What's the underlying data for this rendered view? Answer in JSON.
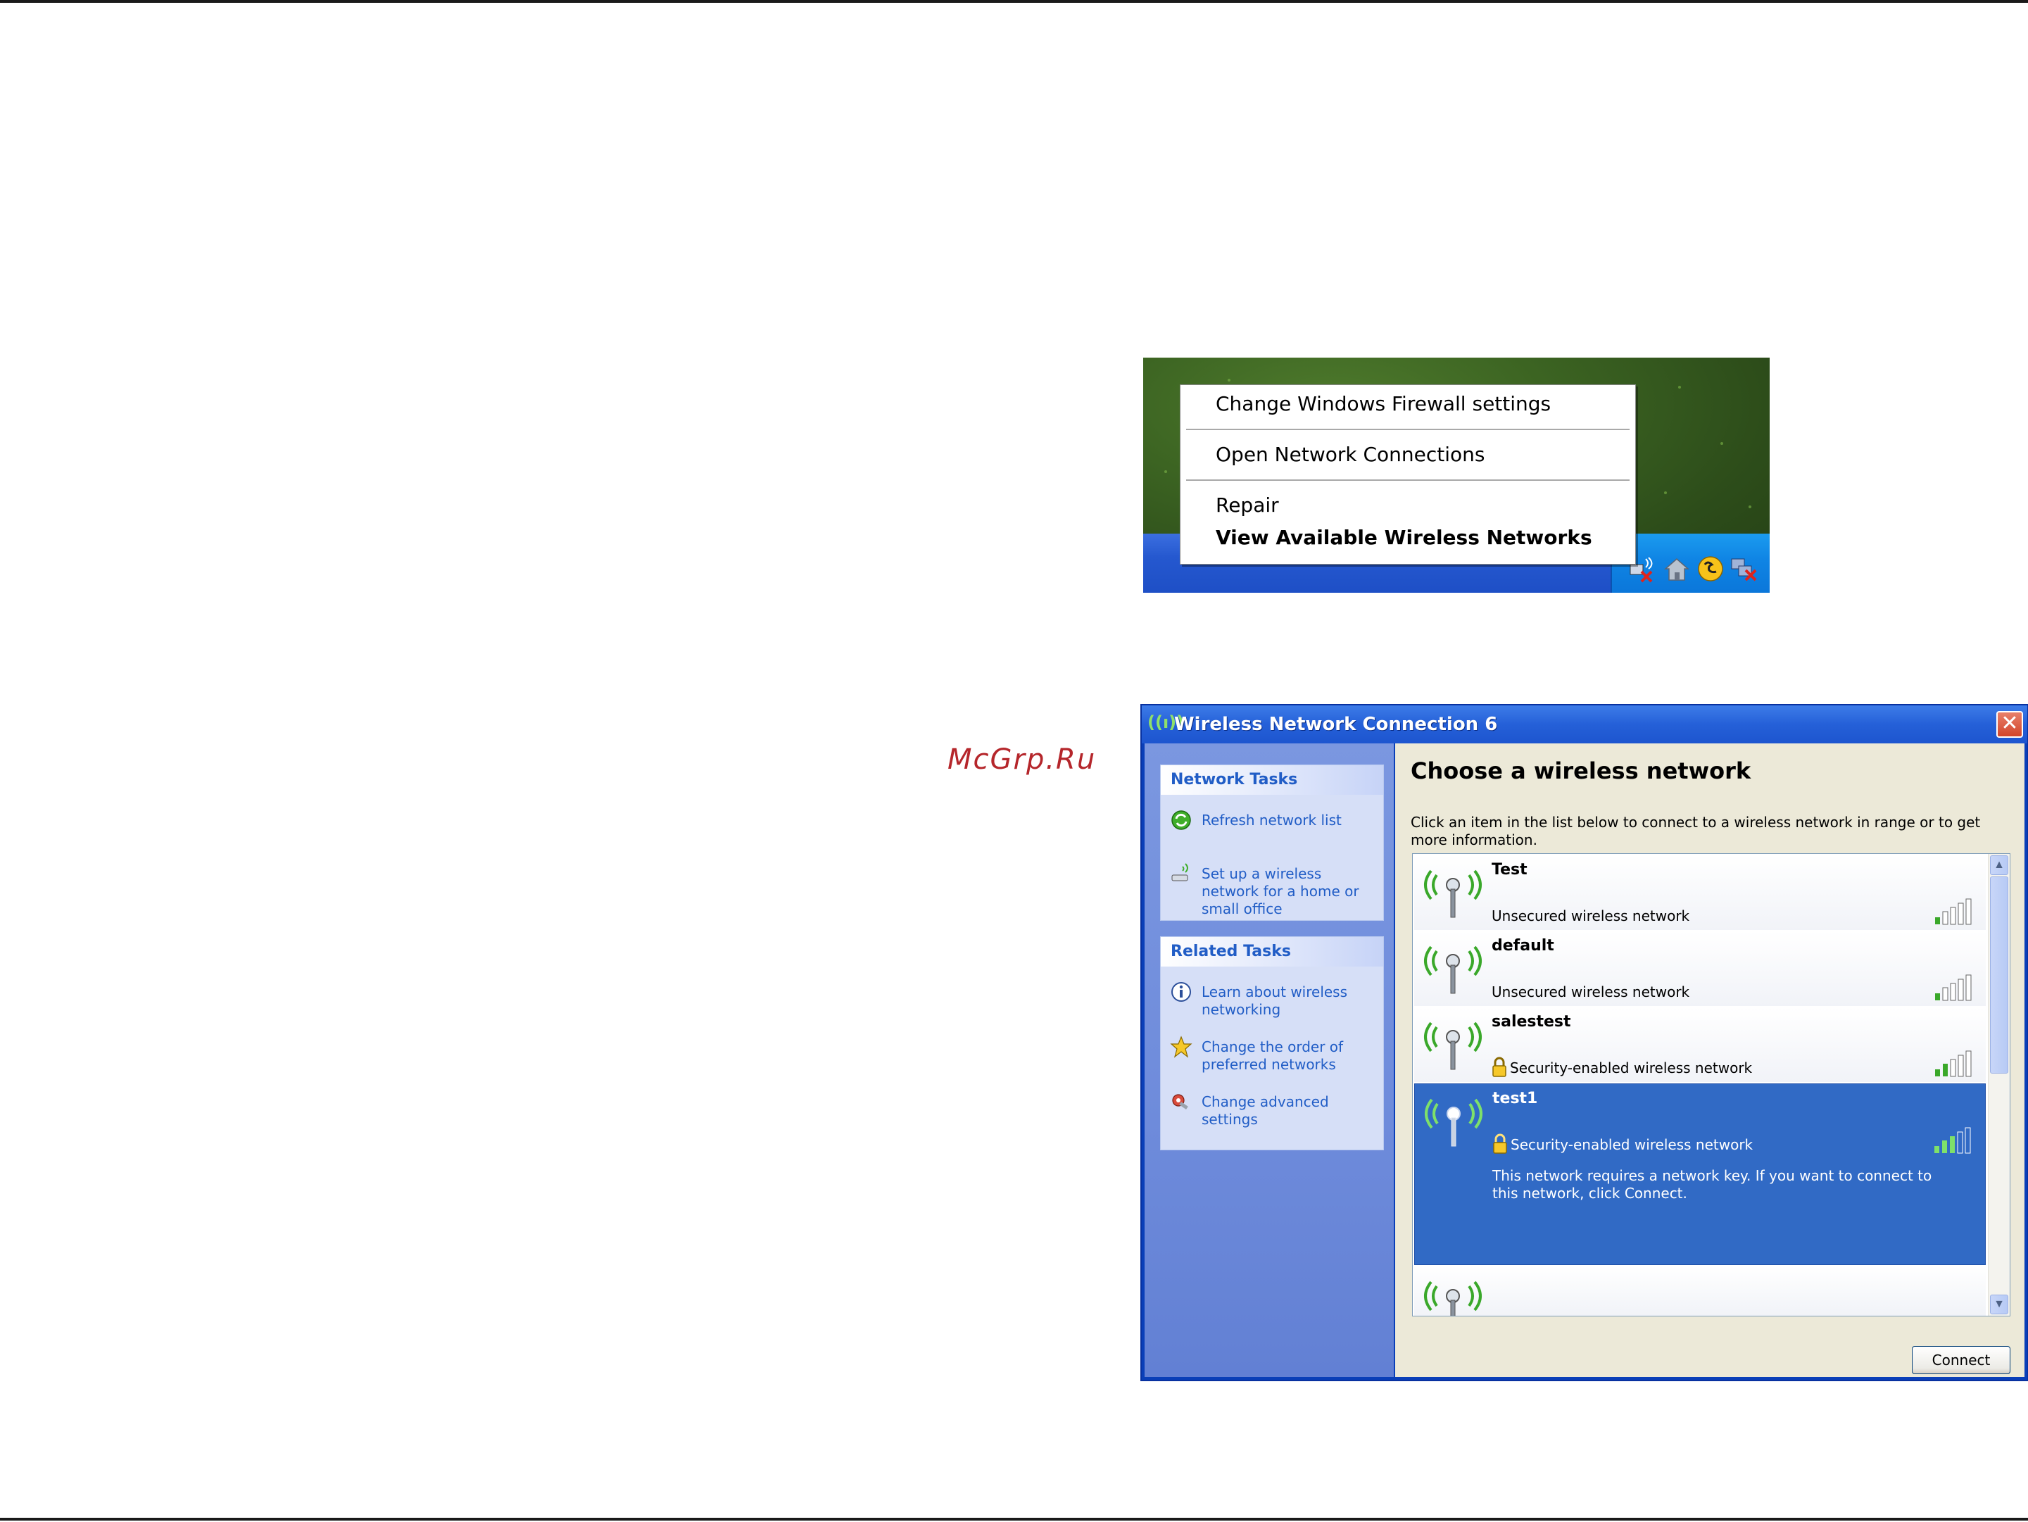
{
  "watermark": "McGrp.Ru",
  "context_menu": {
    "items": [
      {
        "label": "Change Windows Firewall settings"
      },
      {
        "label": "Open Network Connections"
      },
      {
        "label": "Repair"
      },
      {
        "label": "View Available Wireless Networks",
        "bold": true
      }
    ],
    "tray_icons": [
      "network-disconnected-icon",
      "home-icon",
      "security-alert-icon",
      "network-disconnected-icon"
    ]
  },
  "dialog": {
    "title": "Wireless Network Connection 6",
    "close_label": "✕",
    "network_tasks": {
      "heading": "Network Tasks",
      "items": [
        {
          "label": "Refresh network list",
          "icon": "refresh-icon"
        },
        {
          "label": "Set up a wireless network for a home or small office",
          "icon": "setup-wireless-icon"
        }
      ]
    },
    "related_tasks": {
      "heading": "Related Tasks",
      "items": [
        {
          "label": "Learn about wireless networking",
          "icon": "info-icon"
        },
        {
          "label": "Change the order of preferred networks",
          "icon": "star-icon"
        },
        {
          "label": "Change advanced settings",
          "icon": "settings-icon"
        }
      ]
    },
    "heading": "Choose a wireless network",
    "instructions": "Click an item in the list below to connect to a wireless network in range or to get more information.",
    "networks": [
      {
        "name": "Test",
        "status": "Unsecured wireless network",
        "secured": false,
        "signal_bars": 1,
        "selected": false
      },
      {
        "name": "default",
        "status": "Unsecured wireless network",
        "secured": false,
        "signal_bars": 1,
        "selected": false
      },
      {
        "name": "salestest",
        "status": "Security-enabled wireless network",
        "secured": true,
        "signal_bars": 2,
        "selected": false
      },
      {
        "name": "test1",
        "status": "Security-enabled wireless network",
        "secured": true,
        "signal_bars": 3,
        "selected": true,
        "description": "This network requires a network key. If you want to connect to this network, click Connect."
      }
    ],
    "connect_button": "Connect"
  }
}
